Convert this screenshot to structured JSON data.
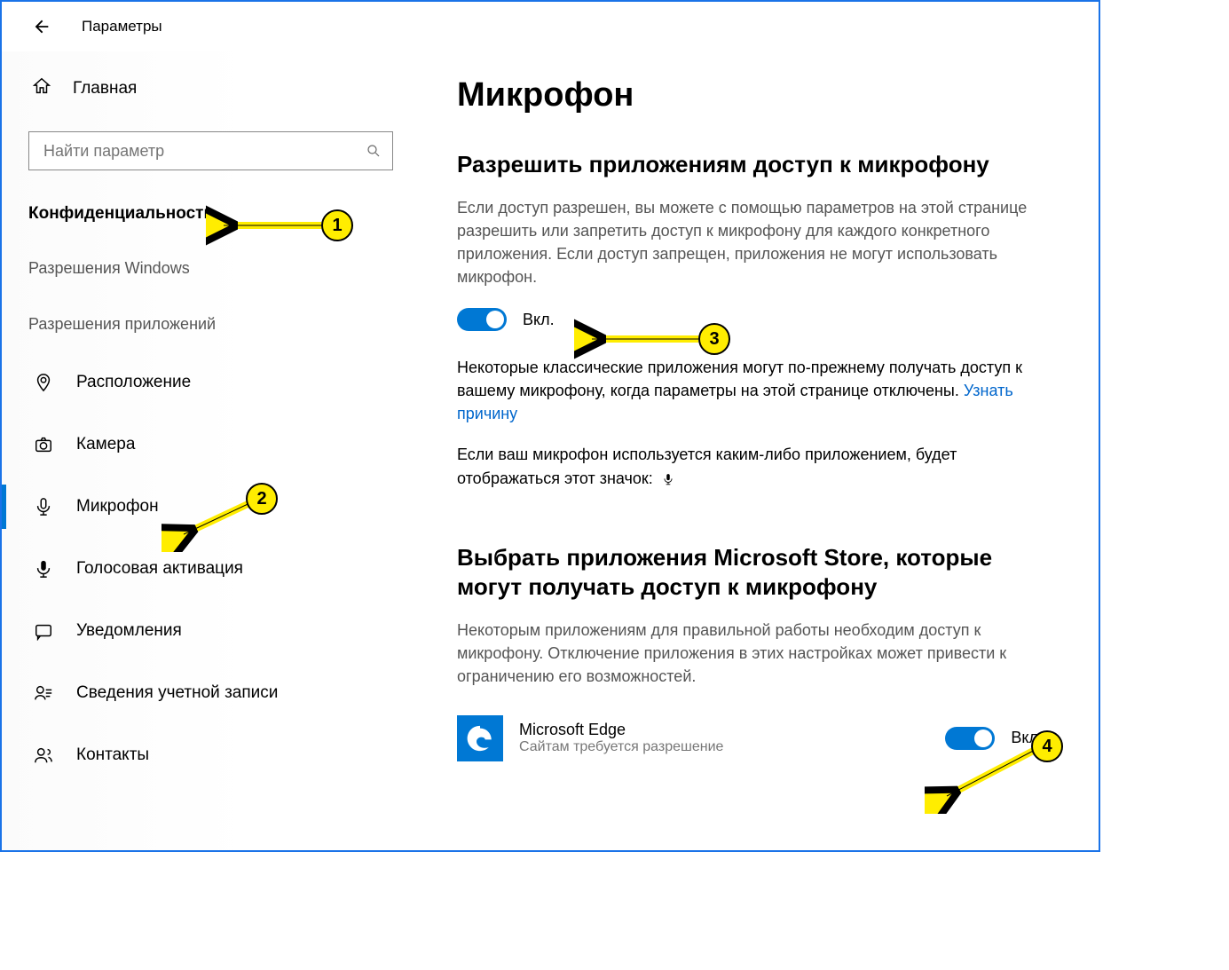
{
  "header": {
    "title": "Параметры"
  },
  "sidebar": {
    "home": "Главная",
    "search_placeholder": "Найти параметр",
    "category": "Конфиденциальность",
    "group_windows": "Разрешения Windows",
    "group_apps": "Разрешения приложений",
    "items": [
      {
        "label": "Расположение"
      },
      {
        "label": "Камера"
      },
      {
        "label": "Микрофон"
      },
      {
        "label": "Голосовая активация"
      },
      {
        "label": "Уведомления"
      },
      {
        "label": "Сведения учетной записи"
      },
      {
        "label": "Контакты"
      }
    ]
  },
  "main": {
    "title": "Микрофон",
    "section1_heading": "Разрешить приложениям доступ к микрофону",
    "section1_desc": "Если доступ разрешен, вы можете с помощью параметров на этой странице разрешить или запретить доступ к микрофону для каждого конкретного приложения. Если доступ запрещен, приложения не могут использовать микрофон.",
    "toggle1_label": "Вкл.",
    "classic_desc_pre": "Некоторые классические приложения могут по-прежнему получать доступ к вашему микрофону, когда параметры на этой странице отключены. ",
    "classic_desc_link": "Узнать причину",
    "indicator_text": "Если ваш микрофон используется каким-либо приложением, будет отображаться этот значок:",
    "section2_heading": "Выбрать приложения Microsoft Store, которые могут получать доступ к микрофону",
    "section2_desc": "Некоторым приложениям для правильной работы необходим доступ к микрофону. Отключение приложения в этих настройках может привести к ограничению его возможностей.",
    "app": {
      "name": "Microsoft Edge",
      "sub": "Сайтам требуется разрешение",
      "toggle_label": "Вкл."
    }
  },
  "annotations": {
    "b1": "1",
    "b2": "2",
    "b3": "3",
    "b4": "4"
  }
}
